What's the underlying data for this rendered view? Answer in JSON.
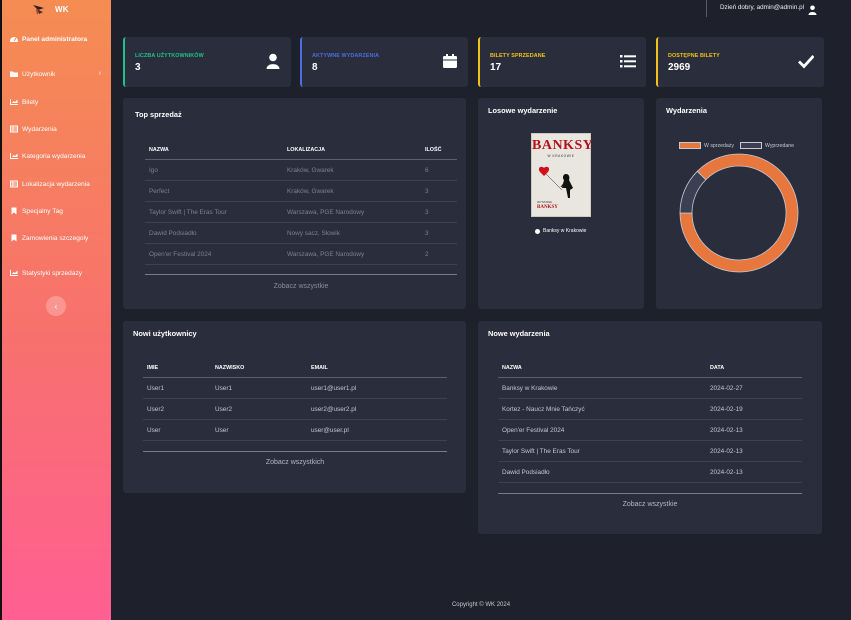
{
  "brand": {
    "name": "WK"
  },
  "sidebar": {
    "items": [
      {
        "label": "Panel administratora",
        "icon": "dashboard-icon"
      },
      {
        "label": "Użytkownik",
        "icon": "folder-icon",
        "chevron": "›"
      },
      {
        "label": "Bilety",
        "icon": "chart-icon"
      },
      {
        "label": "Wydarzenia",
        "icon": "table-icon"
      },
      {
        "label": "Kategoria wydarzenia",
        "icon": "chart-icon"
      },
      {
        "label": "Lokalizacja wydarzenia",
        "icon": "table-icon"
      },
      {
        "label": "Specjalny Tag",
        "icon": "bookmark-icon"
      },
      {
        "label": "Zamowienia szczegoly",
        "icon": "bookmark-icon"
      },
      {
        "label": "Statystyki sprzedazy",
        "icon": "chart-icon"
      }
    ],
    "collapse_label": "‹"
  },
  "topbar": {
    "greeting": "Dzień dobry, admin@admin.pl"
  },
  "stats": [
    {
      "label": "LICZBA UŻYTKOWNIKÓW",
      "value": "3",
      "color": "#1fc38a",
      "icon": "user-icon"
    },
    {
      "label": "AKTYWNE WYDARZENIA",
      "value": "8",
      "color": "#4a6fdc",
      "icon": "calendar-icon"
    },
    {
      "label": "BILETY SPRZEDANE",
      "value": "17",
      "color": "#f2c21c",
      "icon": "list-icon"
    },
    {
      "label": "DOSTĘPNE BILETY",
      "value": "2969",
      "color": "#f2c21c",
      "icon": "check-icon"
    }
  ],
  "top_sales": {
    "title": "Top sprzedaż",
    "headers": [
      "NAZWA",
      "LOKALIZACJA",
      "ILOŚĆ"
    ],
    "rows": [
      [
        "Igo",
        "Kraków, Gwarek",
        "6"
      ],
      [
        "Perfect",
        "Kraków, Gwarek",
        "3"
      ],
      [
        "Taylor Swift | The Eras Tour",
        "Warszawa, PGE Narodowy",
        "3"
      ],
      [
        "Dawid Podsiadło",
        "Nowy sacz, Słowik",
        "3"
      ],
      [
        "Open'er Festival 2024",
        "Warszawa, PGE Narodowy",
        "2"
      ]
    ],
    "see_all": "Zobacz wszystkie"
  },
  "random_event": {
    "title": "Losowe wydarzenie",
    "poster_title": "BANKSY",
    "poster_subtitle": "W KRAKOWIE",
    "poster_small": "WYSTAWA",
    "poster_bottom": "BANKSY",
    "caption": "Banksy w Krakowie"
  },
  "events_chart": {
    "title": "Wydarzenia",
    "legend": [
      "W sprzedaży",
      "Wyprzedane"
    ]
  },
  "chart_data": {
    "type": "pie",
    "categories": [
      "W sprzedaży",
      "Wyprzedane"
    ],
    "values": [
      7,
      1
    ],
    "colors": [
      "#e8773e",
      "#3a3f52"
    ],
    "border": "#c5cad8",
    "legend": "top"
  },
  "new_users": {
    "title": "Nowi użytkownicy",
    "headers": [
      "IMIE",
      "NAZWISKO",
      "EMAIL"
    ],
    "rows": [
      [
        "User1",
        "User1",
        "user1@user1.pl"
      ],
      [
        "User2",
        "User2",
        "user2@user2.pl"
      ],
      [
        "User",
        "User",
        "user@user.pl"
      ]
    ],
    "see_all": "Zobacz wszystkich"
  },
  "new_events": {
    "title": "Nowe wydarzenia",
    "headers": [
      "NAZWA",
      "DATA"
    ],
    "rows": [
      [
        "Banksy w Krakowie",
        "2024-02-27"
      ],
      [
        "Kortez - Naucz Mnie Tańczyć",
        "2024-02-19"
      ],
      [
        "Open'er Festival 2024",
        "2024-02-13"
      ],
      [
        "Taylor Swift | The Eras Tour",
        "2024-02-13"
      ],
      [
        "Dawid Podsiadło",
        "2024-02-13"
      ]
    ],
    "see_all": "Zobacz wszystkie"
  },
  "footer": {
    "text": "Copyright © WK 2024"
  }
}
